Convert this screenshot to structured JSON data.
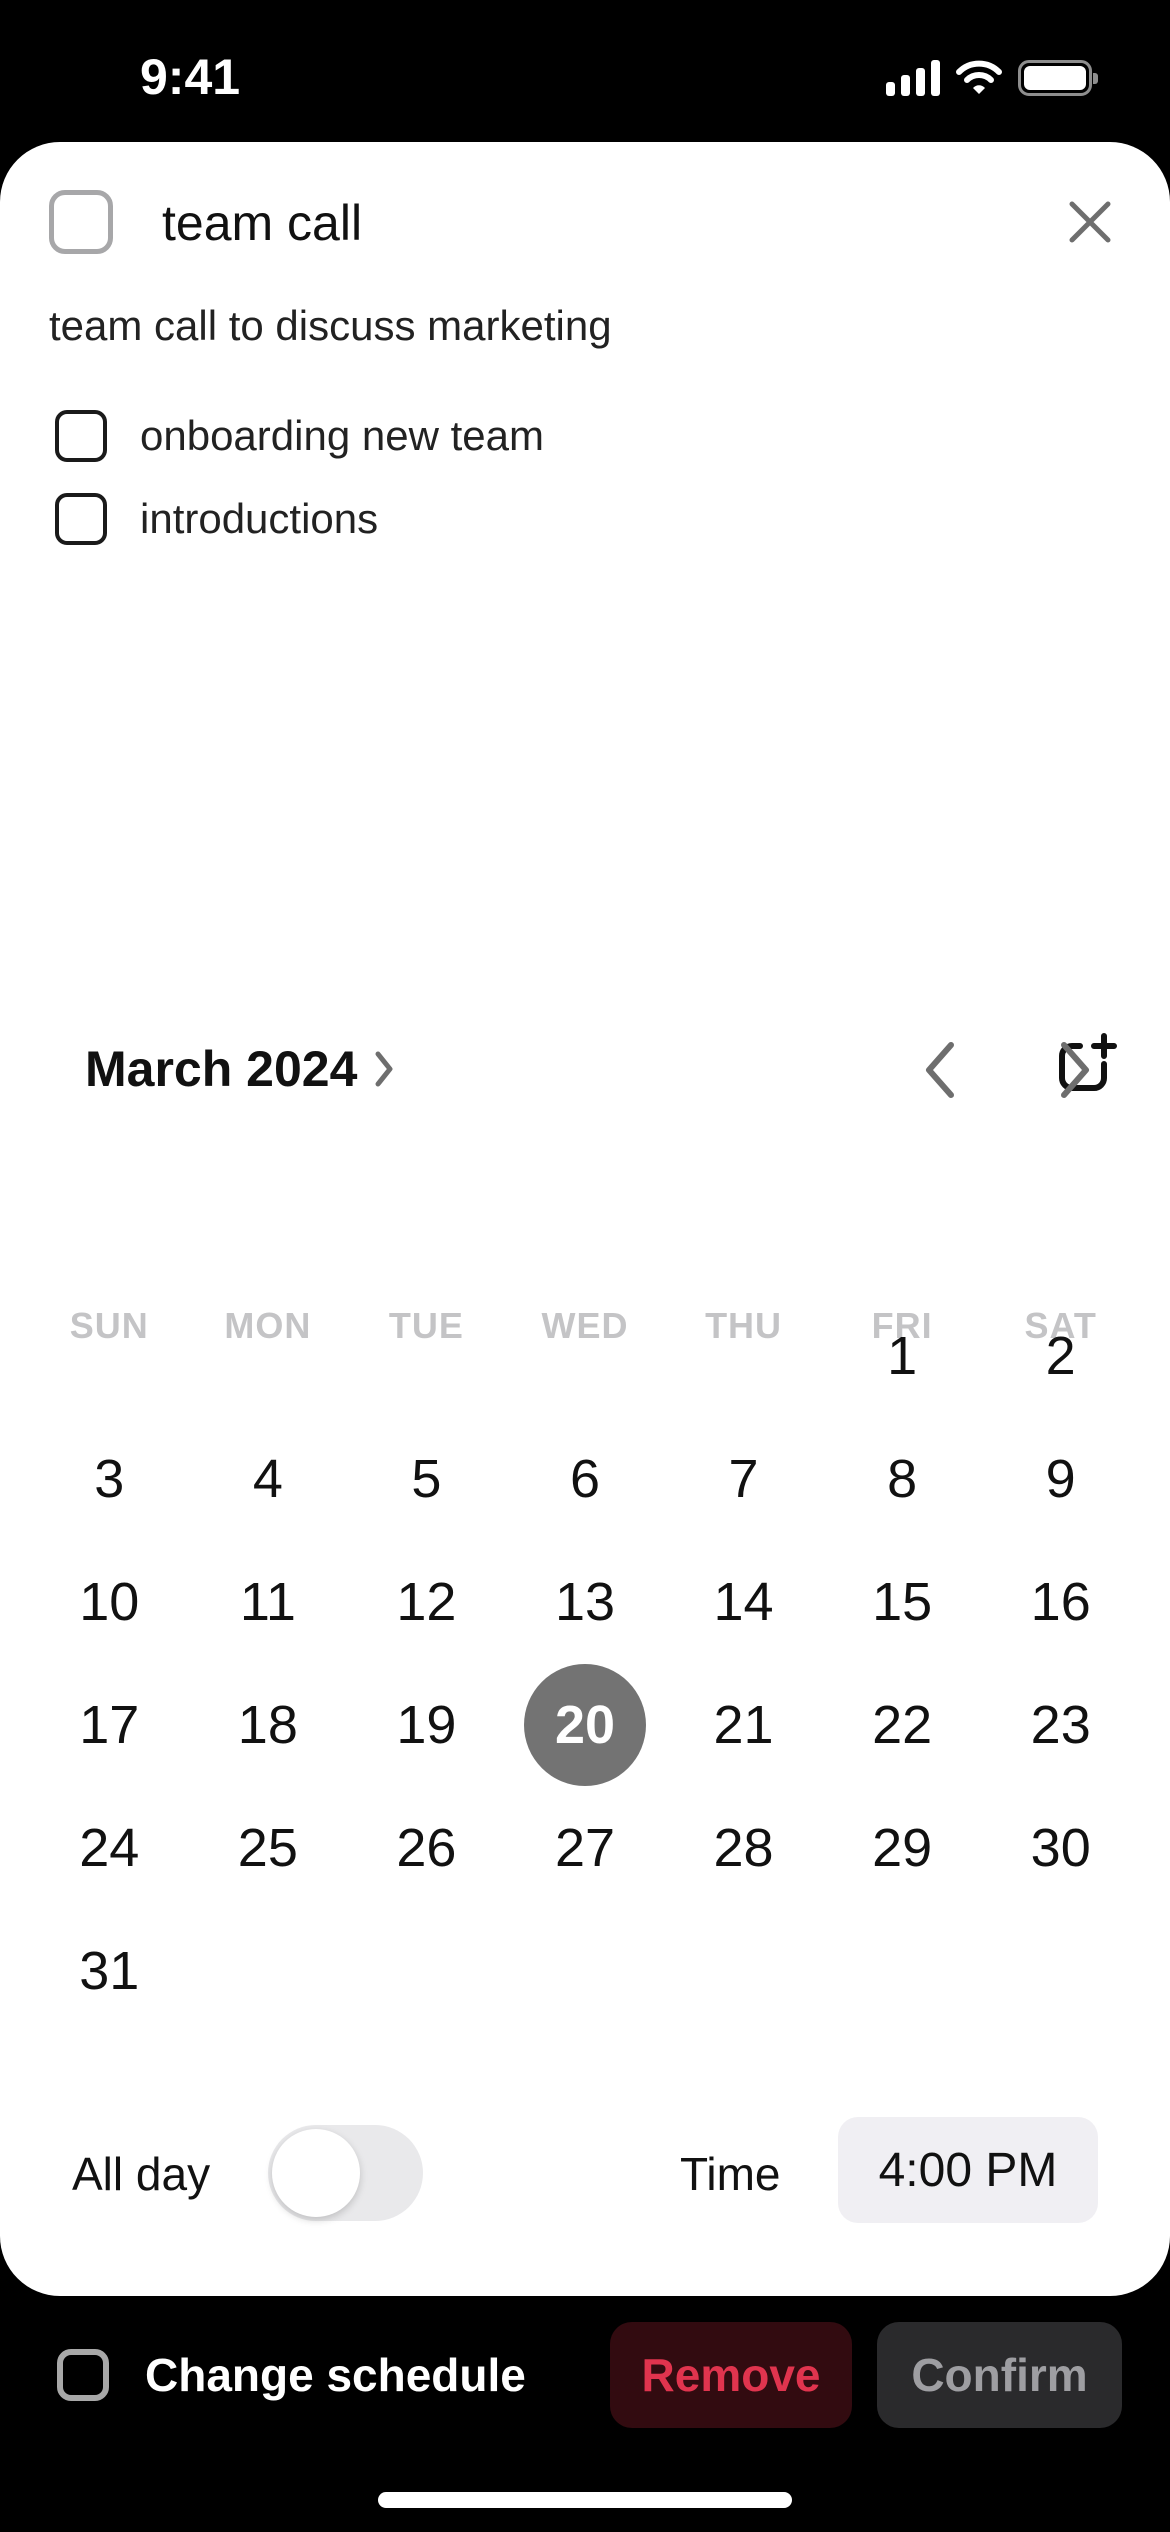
{
  "status_bar": {
    "time": "9:41"
  },
  "task": {
    "title": "team call",
    "description": "team call to discuss marketing",
    "completed": false,
    "subtasks": [
      {
        "label": "onboarding new team",
        "completed": false
      },
      {
        "label": "introductions",
        "completed": false
      }
    ]
  },
  "calendar": {
    "month_label": "March 2024",
    "weekdays": [
      "SUN",
      "MON",
      "TUE",
      "WED",
      "THU",
      "FRI",
      "SAT"
    ],
    "first_weekday_index": 5,
    "days_in_month": 31,
    "selected_day": 20
  },
  "schedule": {
    "all_day_label": "All day",
    "all_day_on": false,
    "time_label": "Time",
    "time_value": "4:00 PM"
  },
  "bottom_bar": {
    "change_schedule_label": "Change schedule",
    "remove_label": "Remove",
    "confirm_label": "Confirm"
  },
  "colors": {
    "selected_day": "#737373",
    "remove_text": "#e0344e",
    "remove_bg": "#320b10",
    "confirm_bg": "#2a2a2c"
  }
}
